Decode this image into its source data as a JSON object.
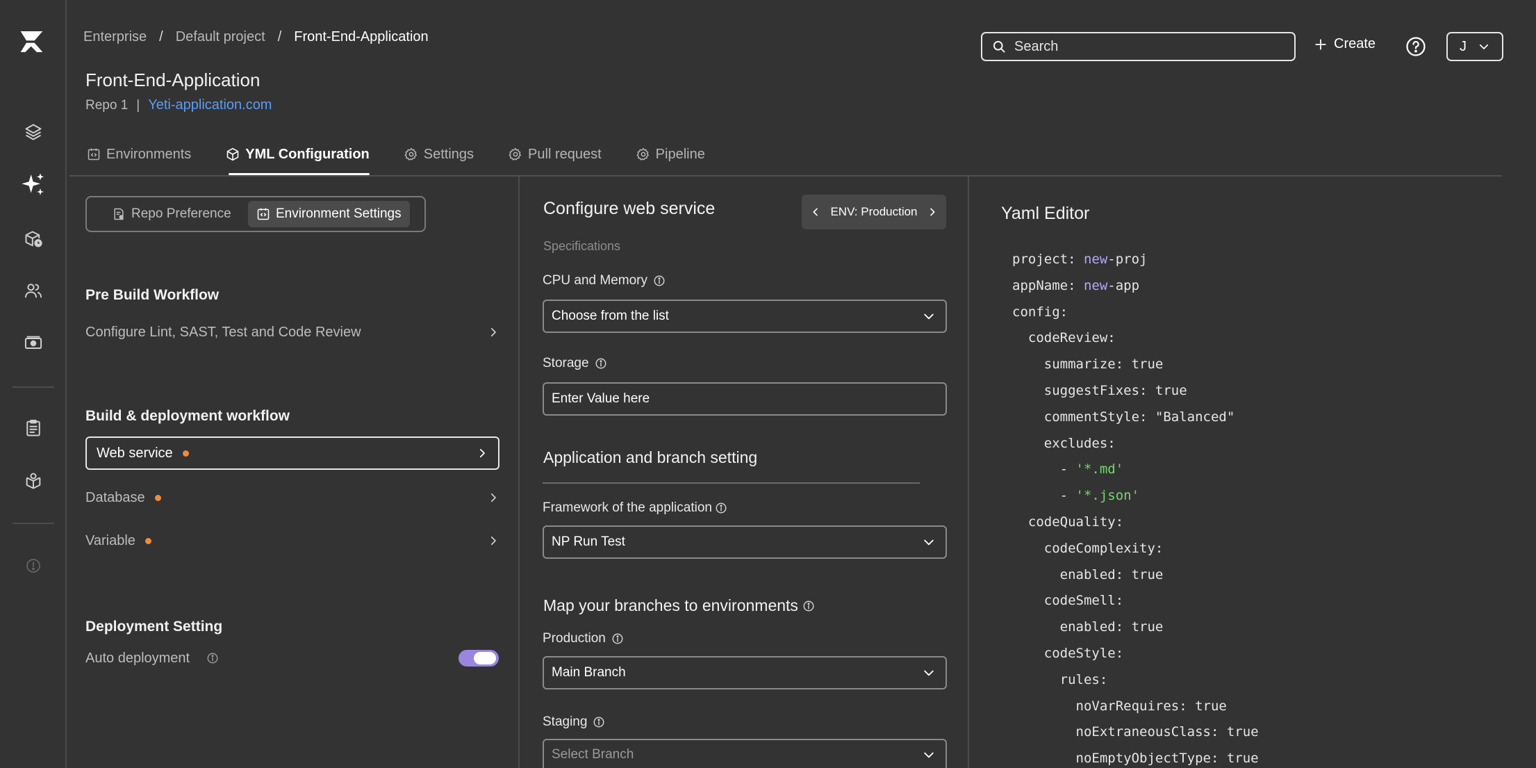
{
  "colors": {
    "background": "#333333",
    "accent_toggle": "#9a86e0",
    "link": "#5b9cf5",
    "status_dot": "#f08a3c",
    "yaml_keyword": "#b7a6ff",
    "yaml_string": "#72d86a"
  },
  "rail": {
    "icons": [
      "logo-icon",
      "layers-icon",
      "sparkles-icon",
      "box-clock-icon",
      "users-icon",
      "billing-icon",
      "clipboard-icon",
      "package-icon",
      "alert-icon"
    ]
  },
  "breadcrumb": {
    "items": [
      "Enterprise",
      "Default project",
      "Front-End-Application"
    ]
  },
  "page": {
    "title": "Front-End-Application",
    "repo_label": "Repo 1",
    "repo_separator": "|",
    "repo_link": "Yeti-application.com"
  },
  "header": {
    "search_placeholder": "Search",
    "create_label": "Create",
    "user_initial": "J"
  },
  "tabs": [
    {
      "label": "Environments",
      "icon": "env-icon"
    },
    {
      "label": "YML Configuration",
      "icon": "cube-icon",
      "active": true
    },
    {
      "label": "Settings",
      "icon": "gear-icon"
    },
    {
      "label": "Pull request",
      "icon": "gear-icon"
    },
    {
      "label": "Pipeline",
      "icon": "gear-icon"
    }
  ],
  "left": {
    "segments": [
      "Repo Preference",
      "Environment Settings"
    ],
    "pre_build": {
      "heading": "Pre Build Workflow",
      "item": "Configure Lint, SAST, Test and Code Review"
    },
    "build": {
      "heading": "Build & deployment workflow",
      "items": [
        "Web service",
        "Database",
        "Variable"
      ]
    },
    "deployment": {
      "heading": "Deployment Setting",
      "auto_label": "Auto deployment",
      "auto_enabled": true
    }
  },
  "middle": {
    "title": "Configure web service",
    "env_button": "ENV: Production",
    "specs_label": "Specifications",
    "cpu_label": "CPU and Memory",
    "cpu_value": "Choose from the list",
    "storage_label": "Storage",
    "storage_placeholder": "Enter Value here",
    "app_section": "Application and branch setting",
    "framework_label": "Framework of the application",
    "framework_value": "NP Run Test",
    "map_section": "Map your branches to environments",
    "production_label": "Production",
    "production_value": "Main Branch",
    "staging_label": "Staging",
    "staging_placeholder": "Select Branch"
  },
  "yaml": {
    "title": "Yaml Editor",
    "lines": [
      "project: new-proj",
      "appName: new-app",
      "config:",
      "  codeReview:",
      "    summarize: true",
      "    suggestFixes: true",
      "    commentStyle: \"Balanced\"",
      "    excludes:",
      "      - '*.md'",
      "      - '*.json'",
      "  codeQuality:",
      "    codeComplexity:",
      "      enabled: true",
      "    codeSmell:",
      "      enabled: true",
      "    codeStyle:",
      "      rules:",
      "        noVarRequires: true",
      "        noExtraneousClass: true",
      "        noEmptyObjectType: true"
    ]
  }
}
